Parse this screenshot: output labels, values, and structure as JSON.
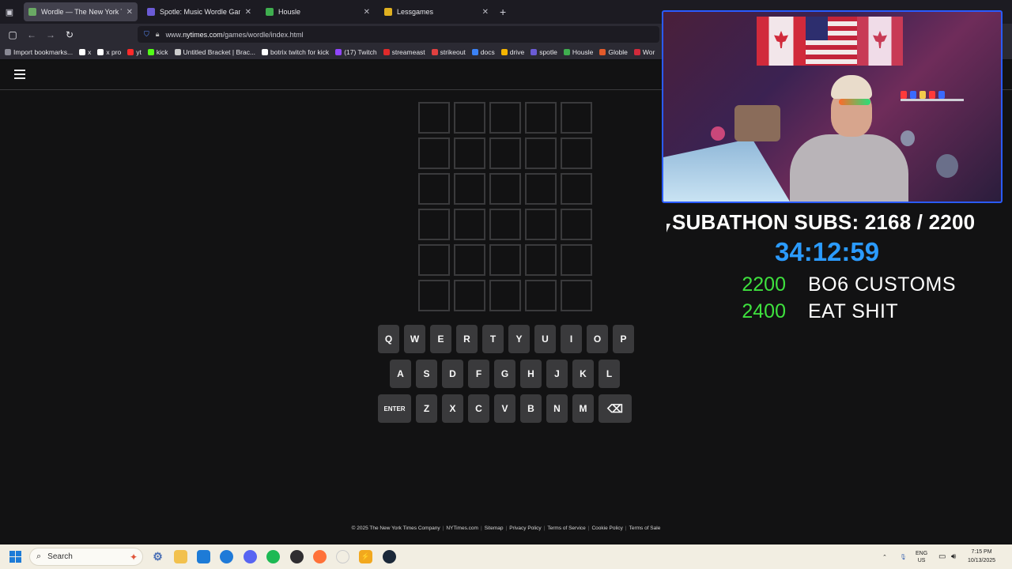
{
  "browser": {
    "tabs": [
      {
        "label": "Wordle — The New York Times",
        "active": true,
        "favicon_color": "#6aaa64"
      },
      {
        "label": "Spotle: Music Wordle Game",
        "active": false,
        "favicon_color": "#6b5bd6"
      },
      {
        "label": "Housle",
        "active": false,
        "favicon_color": "#3fae4f"
      },
      {
        "label": "Lessgames",
        "active": false,
        "favicon_color": "#e0b020"
      }
    ],
    "url_prefix": "www.",
    "url_domain": "nytimes.com",
    "url_path": "/games/wordle/index.html",
    "bookmarks": [
      {
        "label": "Import bookmarks...",
        "color": "#8a8a95"
      },
      {
        "label": "x",
        "color": "#ffffff"
      },
      {
        "label": "x pro",
        "color": "#ffffff"
      },
      {
        "label": "yt",
        "color": "#ff2a2a"
      },
      {
        "label": "kick",
        "color": "#53fc18"
      },
      {
        "label": "Untitled Bracket | Brac...",
        "color": "#cccccc"
      },
      {
        "label": "botrix twitch for kick",
        "color": "#ffffff"
      },
      {
        "label": "(17) Twitch",
        "color": "#9146ff"
      },
      {
        "label": "streameast",
        "color": "#e02a2a"
      },
      {
        "label": "strikeout",
        "color": "#e04040"
      },
      {
        "label": "docs",
        "color": "#3b82f6"
      },
      {
        "label": "drive",
        "color": "#f4b400"
      },
      {
        "label": "spotle",
        "color": "#6b5bd6"
      },
      {
        "label": "Housle",
        "color": "#3fae4f"
      },
      {
        "label": "Globle",
        "color": "#e25a2a"
      },
      {
        "label": "Wor",
        "color": "#d12a3b"
      }
    ]
  },
  "wordle": {
    "keyboard": {
      "row1": [
        "Q",
        "W",
        "E",
        "R",
        "T",
        "Y",
        "U",
        "I",
        "O",
        "P"
      ],
      "row2": [
        "A",
        "S",
        "D",
        "F",
        "G",
        "H",
        "J",
        "K",
        "L"
      ],
      "row3": [
        "ENTER",
        "Z",
        "X",
        "C",
        "V",
        "B",
        "N",
        "M",
        "⌫"
      ]
    },
    "footer": [
      "© 2025 The New York Times Company",
      "NYTimes.com",
      "Sitemap",
      "Privacy Policy",
      "Terms of Service",
      "Cookie Policy",
      "Terms of Sale"
    ]
  },
  "overlay": {
    "subs_label": "SUBATHON SUBS: 2168 / 2200",
    "timer": "34:12:59",
    "goals": [
      {
        "number": "2200",
        "text": "BO6 CUSTOMS"
      },
      {
        "number": "2400",
        "text": "EAT SHIT"
      }
    ]
  },
  "taskbar": {
    "search_placeholder": "Search",
    "lang_top": "ENG",
    "lang_bottom": "US",
    "time": "7:15 PM",
    "date": "10/13/2025"
  }
}
